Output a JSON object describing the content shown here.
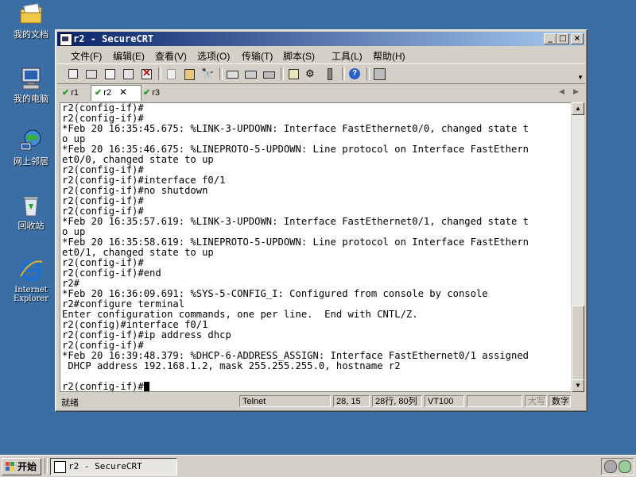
{
  "desktop": {
    "icons": [
      {
        "label": "我的文档",
        "icon": "folder-icon"
      },
      {
        "label": "我的电脑",
        "icon": "computer-icon"
      },
      {
        "label": "网上邻居",
        "icon": "network-icon"
      },
      {
        "label": "回收站",
        "icon": "recycle-bin-icon"
      },
      {
        "label": "Internet Explorer",
        "icon": "internet-explorer-icon"
      }
    ],
    "background": "#3a6ea5"
  },
  "window": {
    "title": "r2 - SecureCRT",
    "controls": {
      "minimize": "_",
      "maximize": "□",
      "close": "×"
    },
    "menu": [
      "文件(F)",
      "编辑(E)",
      "查看(V)",
      "选项(O)",
      "传输(T)",
      "脚本(S)",
      "工具(L)",
      "帮助(H)"
    ],
    "tabs": [
      {
        "label": "r1",
        "active": false
      },
      {
        "label": "r2",
        "active": true
      },
      {
        "label": "r3",
        "active": false
      }
    ],
    "terminal_lines": [
      "r2(config-if)#",
      "r2(config-if)#",
      "*Feb 20 16:35:45.675: %LINK-3-UPDOWN: Interface FastEthernet0/0, changed state t",
      "o up",
      "*Feb 20 16:35:46.675: %LINEPROTO-5-UPDOWN: Line protocol on Interface FastEthern",
      "et0/0, changed state to up",
      "r2(config-if)#",
      "r2(config-if)#interface f0/1",
      "r2(config-if)#no shutdown",
      "r2(config-if)#",
      "r2(config-if)#",
      "*Feb 20 16:35:57.619: %LINK-3-UPDOWN: Interface FastEthernet0/1, changed state t",
      "o up",
      "*Feb 20 16:35:58.619: %LINEPROTO-5-UPDOWN: Line protocol on Interface FastEthern",
      "et0/1, changed state to up",
      "r2(config-if)#",
      "r2(config-if)#end",
      "r2#",
      "*Feb 20 16:36:09.691: %SYS-5-CONFIG_I: Configured from console by console",
      "r2#configure terminal",
      "Enter configuration commands, one per line.  End with CNTL/Z.",
      "r2(config)#interface f0/1",
      "r2(config-if)#ip address dhcp",
      "r2(config-if)#",
      "*Feb 20 16:39:48.379: %DHCP-6-ADDRESS_ASSIGN: Interface FastEthernet0/1 assigned",
      " DHCP address 192.168.1.2, mask 255.255.255.0, hostname r2",
      ""
    ],
    "prompt": "r2(config-if)#",
    "status": {
      "ready": "就绪",
      "protocol": "Telnet",
      "cursor_pos": "28, 15",
      "size": "28行, 80列",
      "emulation": "VT100",
      "caps": "大写",
      "num": "数字"
    }
  },
  "taskbar": {
    "start_label": "开始",
    "task_title": "r2 - SecureCRT"
  }
}
